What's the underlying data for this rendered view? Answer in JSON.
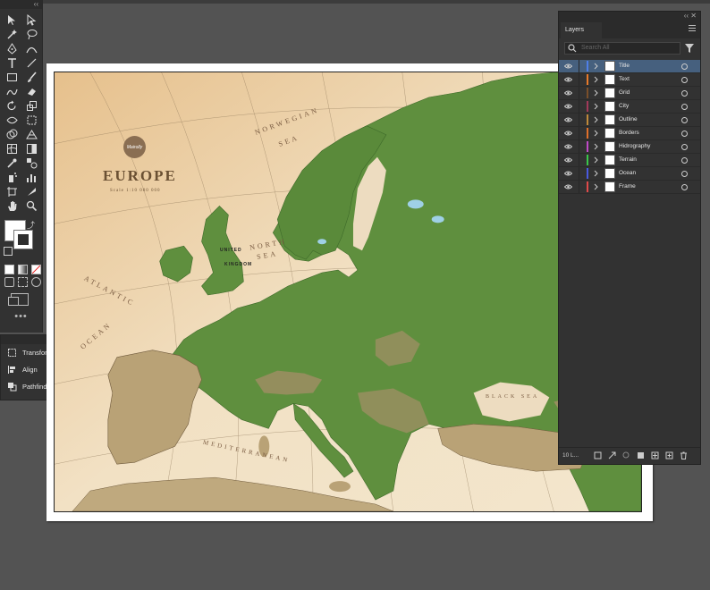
{
  "colors": {
    "ui_bg": "#535353",
    "panel": "#323232",
    "selected_row": "#46607e",
    "land_green": "#5a8a3c",
    "lowland_tan": "#e9cfa4",
    "title_brown": "#6a5033"
  },
  "tools_panel": {
    "icons": [
      "selection-icon",
      "direct-selection-icon",
      "magic-wand-icon",
      "lasso-icon",
      "pen-icon",
      "curvature-icon",
      "type-icon",
      "line-segment-icon",
      "rectangle-icon",
      "paintbrush-icon",
      "shaper-icon",
      "eraser-icon",
      "rotate-icon",
      "scale-icon",
      "width-icon",
      "free-transform-icon",
      "shape-builder-icon",
      "perspective-grid-icon",
      "mesh-icon",
      "gradient-icon",
      "eyedropper-icon",
      "blend-icon",
      "symbol-sprayer-icon",
      "graph-icon",
      "artboard-icon",
      "slice-icon",
      "hand-icon",
      "zoom-icon"
    ],
    "more_label": "•••"
  },
  "side_panel": {
    "items": [
      {
        "label": "Transform",
        "icon": "transform-icon"
      },
      {
        "label": "Align",
        "icon": "align-icon"
      },
      {
        "label": "Pathfinder",
        "icon": "pathfinder-icon"
      }
    ]
  },
  "map": {
    "title": "EUROPE",
    "scale": "Scale 1:10 000 000",
    "logo": "Mairolly",
    "sea_labels": [
      "NORWEGIAN",
      "SEA",
      "NORTH",
      "SEA",
      "ATLANTIC",
      "OCEAN",
      "BLACK SEA",
      "MEDITERRANEAN"
    ],
    "country_labels": [
      "UNITED",
      "KINGDOM"
    ]
  },
  "layers_panel": {
    "tab": "Layers",
    "search_placeholder": "Search All",
    "layers": [
      {
        "name": "Title",
        "color": "#4f7fe8",
        "selected": true
      },
      {
        "name": "Text",
        "color": "#e87a2a",
        "selected": false
      },
      {
        "name": "Grid",
        "color": "#7a4f2a",
        "selected": false
      },
      {
        "name": "City",
        "color": "#a23a5a",
        "selected": false
      },
      {
        "name": "Outline",
        "color": "#c08a3a",
        "selected": false
      },
      {
        "name": "Borders",
        "color": "#e0702a",
        "selected": false
      },
      {
        "name": "Hidrography",
        "color": "#c04ac8",
        "selected": false
      },
      {
        "name": "Terrain",
        "color": "#3ac84a",
        "selected": false
      },
      {
        "name": "Ocean",
        "color": "#4a5ae0",
        "selected": false
      },
      {
        "name": "Frame",
        "color": "#e04a4a",
        "selected": false
      }
    ],
    "footer_count": "10 L..."
  }
}
